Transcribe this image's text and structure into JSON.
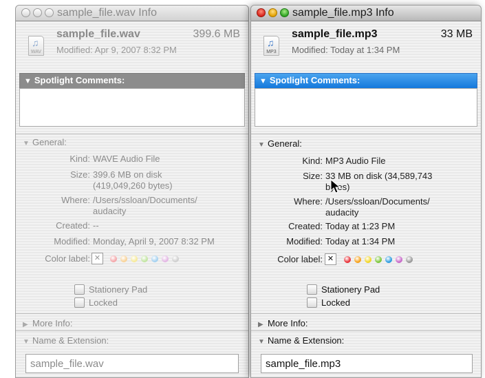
{
  "windows": [
    {
      "id": "left",
      "state": "inactive",
      "title": "sample_file.wav Info",
      "file": {
        "name": "sample_file.wav",
        "size": "399.6 MB",
        "modified": "Modified: Apr 9, 2007 8:32 PM",
        "icon": "wav-file-icon",
        "ext_label": "WAV"
      },
      "spotlight_label": "Spotlight Comments:",
      "general_label": "General:",
      "general": {
        "kind_label": "Kind:",
        "kind": "WAVE Audio File",
        "size_label": "Size:",
        "size_line1": "399.6 MB on disk",
        "size_line2": "(419,049,260 bytes)",
        "where_label": "Where:",
        "where_line1": "/Users/ssloan/Documents/",
        "where_line2": "audacity",
        "created_label": "Created:",
        "created": "--",
        "modified_label": "Modified:",
        "modified": "Monday, April 9, 2007 8:32 PM",
        "color_label": "Color label:"
      },
      "stationery_label": "Stationery Pad",
      "locked_label": "Locked",
      "more_info_label": "More Info:",
      "name_ext_label": "Name & Extension:",
      "name_value": "sample_file.wav"
    },
    {
      "id": "right",
      "state": "active",
      "title": "sample_file.mp3 Info",
      "file": {
        "name": "sample_file.mp3",
        "size": "33 MB",
        "modified": "Modified: Today at 1:34 PM",
        "icon": "mp3-file-icon",
        "ext_label": "MP3"
      },
      "spotlight_label": "Spotlight Comments:",
      "general_label": "General:",
      "general": {
        "kind_label": "Kind:",
        "kind": "MP3 Audio File",
        "size_label": "Size:",
        "size_line1": "33 MB on disk (34,589,743",
        "size_line2": "bytes)",
        "where_label": "Where:",
        "where_line1": "/Users/ssloan/Documents/",
        "where_line2": "audacity",
        "created_label": "Created:",
        "created": "Today at 1:23 PM",
        "modified_label": "Modified:",
        "modified": "Today at 1:34 PM",
        "color_label": "Color label:"
      },
      "stationery_label": "Stationery Pad",
      "locked_label": "Locked",
      "more_info_label": "More Info:",
      "name_ext_label": "Name & Extension:",
      "name_value": "sample_file.mp3"
    }
  ],
  "colors": {
    "label_colors_active": [
      "#e8333a",
      "#f6a21c",
      "#f2d629",
      "#7cc63c",
      "#2f9de0",
      "#c86bc9",
      "#9a9a9a"
    ],
    "label_colors_inactive": [
      "#f4a8ab",
      "#f8d39a",
      "#f6ea9c",
      "#c3e5a3",
      "#a5d1f0",
      "#e3b8e4",
      "#cfcfcf"
    ],
    "spotlight_active": "#1478dc",
    "spotlight_inactive": "#8c8c8c"
  },
  "cursor_icon": "arrow-cursor-icon"
}
